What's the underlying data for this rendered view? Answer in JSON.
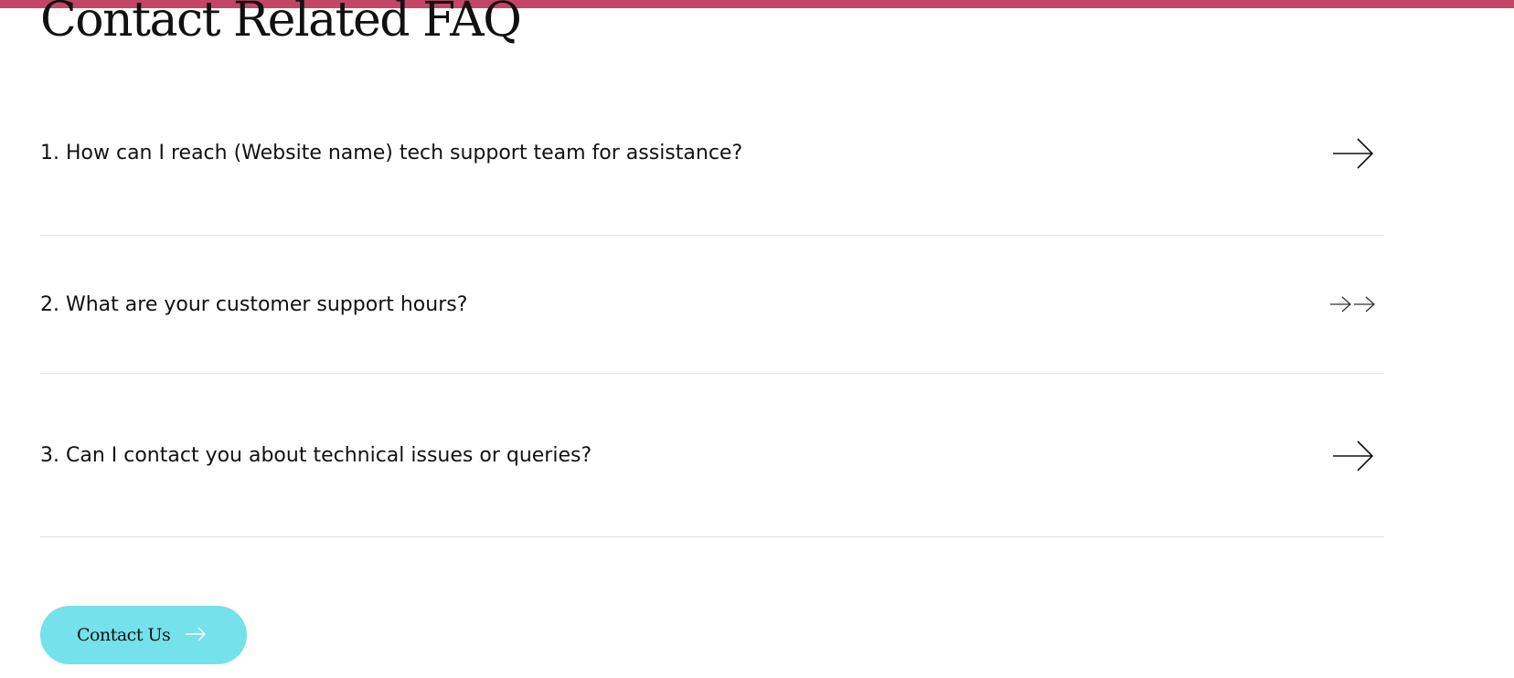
{
  "accent_bar_color": "#c44667",
  "button_color": "#75e1eb",
  "page_title": "Contact Related FAQ",
  "faq": {
    "items": [
      {
        "question": "1. How can I reach (Website name) tech support team for assistance?",
        "icon": "arrow-right-icon"
      },
      {
        "question": "2. What are your customer support hours?",
        "icon": "double-arrow-right-icon"
      },
      {
        "question": "3. Can I contact you about technical issues or queries?",
        "icon": "arrow-right-icon"
      }
    ]
  },
  "contact_button": {
    "label": "Contact Us",
    "icon": "arrow-right-icon"
  }
}
